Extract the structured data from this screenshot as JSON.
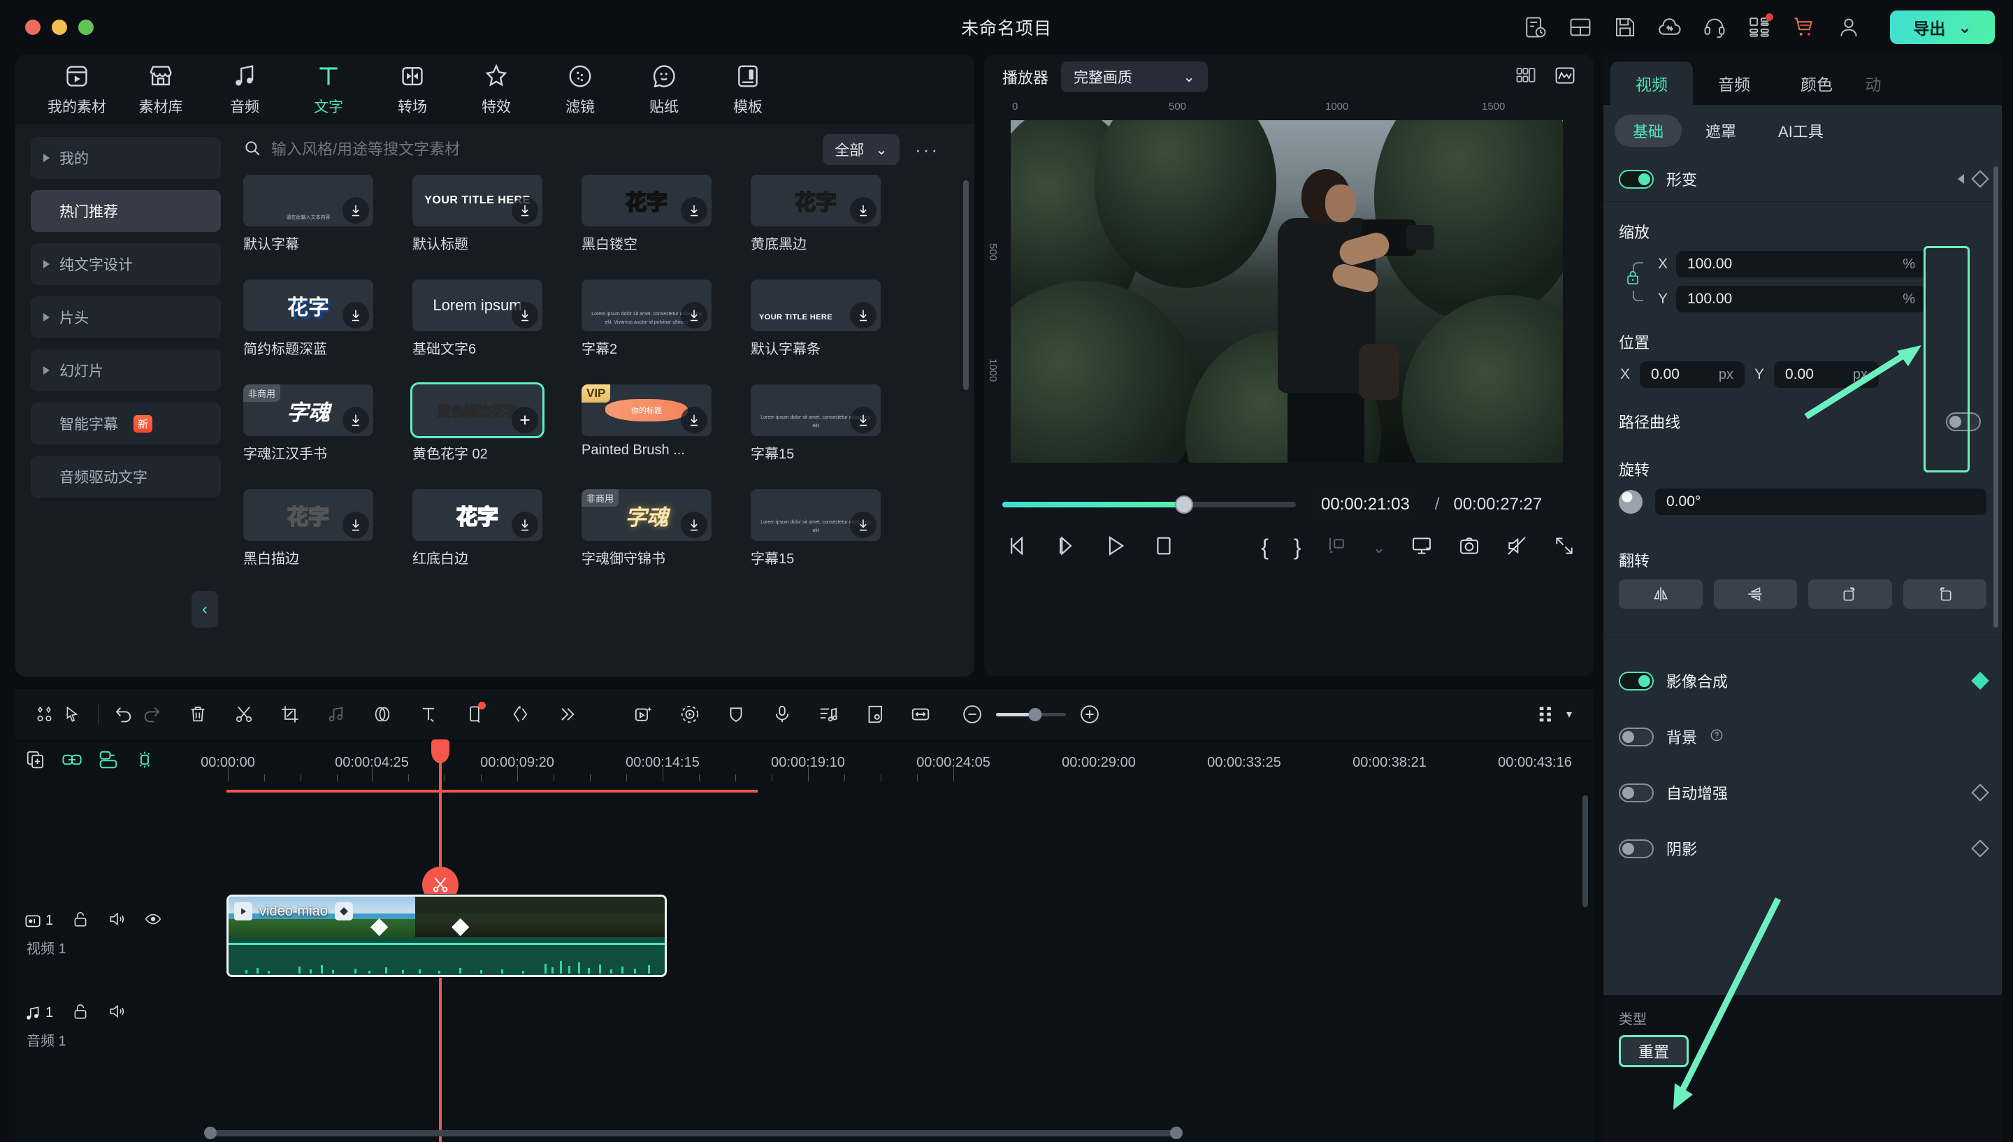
{
  "window": {
    "title": "未命名项目",
    "traffic_lights": [
      "close",
      "minimize",
      "zoom"
    ]
  },
  "titlebar_icons": [
    {
      "name": "task-history-icon"
    },
    {
      "name": "layout-icon"
    },
    {
      "name": "save-icon"
    },
    {
      "name": "cloud-upload-icon"
    },
    {
      "name": "headset-support-icon"
    },
    {
      "name": "apps-grid-icon",
      "badge": true
    },
    {
      "name": "shopping-cart-icon"
    },
    {
      "name": "user-account-icon"
    }
  ],
  "export": {
    "label": "导出",
    "chevron": "⌄"
  },
  "categories": [
    {
      "label": "我的素材",
      "icon": "my-media-icon",
      "active": false
    },
    {
      "label": "素材库",
      "icon": "stock-library-icon",
      "active": false
    },
    {
      "label": "音频",
      "icon": "audio-note-icon",
      "active": false
    },
    {
      "label": "文字",
      "icon": "text-T-icon",
      "active": true
    },
    {
      "label": "转场",
      "icon": "transition-icon",
      "active": false
    },
    {
      "label": "特效",
      "icon": "effects-star-icon",
      "active": false
    },
    {
      "label": "滤镜",
      "icon": "filter-circle-icon",
      "active": false
    },
    {
      "label": "贴纸",
      "icon": "sticker-smile-icon",
      "active": false
    },
    {
      "label": "模板",
      "icon": "template-icon",
      "active": false
    }
  ],
  "sidebar": {
    "items": [
      {
        "label": "我的",
        "expandable": true,
        "active": false,
        "badge": null
      },
      {
        "label": "热门推荐",
        "expandable": false,
        "active": true,
        "badge": null
      },
      {
        "label": "纯文字设计",
        "expandable": true,
        "active": false,
        "badge": null
      },
      {
        "label": "片头",
        "expandable": true,
        "active": false,
        "badge": null
      },
      {
        "label": "幻灯片",
        "expandable": true,
        "active": false,
        "badge": null
      },
      {
        "label": "智能字幕",
        "expandable": false,
        "active": false,
        "badge": "新"
      },
      {
        "label": "音频驱动文字",
        "expandable": false,
        "active": false,
        "badge": null
      }
    ],
    "collapse_icon": "chevron-left-icon"
  },
  "search": {
    "placeholder": "输入风格/用途等搜文字素材",
    "value": "",
    "icon": "search-icon"
  },
  "filter": {
    "label": "全部",
    "chevron": "⌄"
  },
  "more_menu": "···",
  "templates": [
    {
      "name": "默认字幕",
      "style": "micro",
      "preview": "请在此输入文本内容",
      "tag": null,
      "download": true,
      "selected": false
    },
    {
      "name": "默认标题",
      "style": "title-en",
      "preview": "YOUR TITLE HERE",
      "tag": null,
      "download": true,
      "selected": false
    },
    {
      "name": "黑白镂空",
      "style": "hua-white",
      "preview": "花字",
      "tag": null,
      "download": true,
      "selected": false
    },
    {
      "name": "黄底黑边",
      "style": "hua-yellow",
      "preview": "花字",
      "tag": null,
      "download": true,
      "selected": false
    },
    {
      "name": "简约标题深蓝",
      "style": "hua-blue",
      "preview": "花字",
      "tag": null,
      "download": true,
      "selected": false
    },
    {
      "name": "基础文字6",
      "style": "lorem",
      "preview": "Lorem ipsum",
      "tag": null,
      "download": true,
      "selected": false
    },
    {
      "name": "字幕2",
      "style": "micro2",
      "preview": "Lorem ipsum dolor sit amet, consectetur adipiscing elit. Vivamus auctor id pulvinar ultrices",
      "tag": null,
      "download": true,
      "selected": false
    },
    {
      "name": "默认字幕条",
      "style": "sub-title",
      "preview": "YOUR TITLE HERE",
      "tag": null,
      "download": true,
      "selected": false
    },
    {
      "name": "字魂江汉手书",
      "style": "zihun",
      "preview": "字魂",
      "tag": "非商用",
      "download": true,
      "selected": false
    },
    {
      "name": "黄色花字 02",
      "style": "selected-yellow",
      "preview": "黄色描边花字",
      "tag": null,
      "download": false,
      "add": true,
      "selected": true
    },
    {
      "name": "Painted Brush ...",
      "style": "brush",
      "preview": "你的标题",
      "tag": "VIP",
      "download": true,
      "selected": false
    },
    {
      "name": "字幕15",
      "style": "micro3",
      "preview": "Lorem ipsum dolor sit amet, consectetur adipiscing elit",
      "tag": null,
      "download": true,
      "selected": false
    },
    {
      "name": "黑白描边",
      "style": "hua-gray",
      "preview": "花字",
      "tag": null,
      "download": true,
      "selected": false
    },
    {
      "name": "红底白边",
      "style": "hua-red",
      "preview": "花字",
      "tag": null,
      "download": true,
      "selected": false
    },
    {
      "name": "字魂御守锦书",
      "style": "zihun-gold",
      "preview": "字魂",
      "tag": "非商用",
      "download": true,
      "selected": false
    },
    {
      "name": "字幕15",
      "style": "micro3",
      "preview": "Lorem ipsum dolor sit amet, consectetur adipiscing elit",
      "tag": null,
      "download": true,
      "selected": false
    }
  ],
  "player": {
    "title": "播放器",
    "quality": "完整画质",
    "quality_chevron": "⌄",
    "head_icons": [
      {
        "name": "split-view-icon"
      },
      {
        "name": "scope-waveform-icon"
      }
    ],
    "ruler_top": [
      "0",
      "500",
      "1000",
      "1500"
    ],
    "ruler_left": [
      "500",
      "1000"
    ],
    "current_time": "00:00:21:03",
    "separator": "/",
    "total_time": "00:00:27:27",
    "progress_percent": 62,
    "controls": [
      {
        "name": "prev-frame-button",
        "glyph": "prev-frame-icon"
      },
      {
        "name": "next-frame-button",
        "glyph": "next-frame-icon"
      },
      {
        "name": "play-button",
        "glyph": "play-icon"
      },
      {
        "name": "stop-button",
        "glyph": "stop-icon"
      },
      {
        "name": "mark-in-button",
        "glyph": "brace-left-icon"
      },
      {
        "name": "mark-out-button",
        "glyph": "brace-right-icon"
      },
      {
        "name": "keyframe-tool-button",
        "glyph": "keyframe-icon"
      },
      {
        "name": "keyframe-dropdown",
        "glyph": "chevron-down-icon"
      },
      {
        "name": "screen-fit-button",
        "glyph": "monitor-icon"
      },
      {
        "name": "snapshot-button",
        "glyph": "camera-icon"
      },
      {
        "name": "mute-button",
        "glyph": "mute-icon"
      },
      {
        "name": "fullscreen-button",
        "glyph": "expand-icon"
      }
    ]
  },
  "properties": {
    "tabs": [
      {
        "label": "视频",
        "active": true
      },
      {
        "label": "音频",
        "active": false
      },
      {
        "label": "颜色",
        "active": false
      },
      {
        "label": "动",
        "active": false
      }
    ],
    "sub_tabs": [
      {
        "label": "基础",
        "active": true
      },
      {
        "label": "遮罩",
        "active": false
      },
      {
        "label": "AI工具",
        "active": false
      }
    ],
    "transform": {
      "label": "形变",
      "enabled": true,
      "scale_label": "缩放",
      "scale_x_axis": "X",
      "scale_x": "100.00",
      "scale_x_unit": "%",
      "scale_y_axis": "Y",
      "scale_y": "100.00",
      "scale_y_unit": "%",
      "lock_icon": "lock-icon",
      "position_label": "位置",
      "pos_x_axis": "X",
      "pos_x": "0.00",
      "pos_x_unit": "px",
      "pos_y_axis": "Y",
      "pos_y": "0.00",
      "pos_y_unit": "px",
      "path_curve_label": "路径曲线",
      "path_curve_enabled": false,
      "rotate_label": "旋转",
      "rotate_value": "0.00°",
      "flip_label": "翻转",
      "flip_buttons": [
        {
          "name": "flip-horizontal-button"
        },
        {
          "name": "flip-vertical-button"
        },
        {
          "name": "rotate-right-button"
        },
        {
          "name": "rotate-left-button"
        }
      ]
    },
    "compositing": {
      "label": "影像合成",
      "enabled": true
    },
    "background": {
      "label": "背景",
      "enabled": false,
      "help": "?"
    },
    "auto_enhance": {
      "label": "自动增强",
      "enabled": false
    },
    "shadow": {
      "label": "阴影",
      "enabled": false
    },
    "type_label": "类型",
    "reset_label": "重置"
  },
  "timeline": {
    "toolbar_left": [
      {
        "name": "auto-layout-icon",
        "dim": false
      },
      {
        "name": "select-cursor-icon",
        "dim": false
      }
    ],
    "toolbar_edit": [
      {
        "name": "undo-icon",
        "dim": false
      },
      {
        "name": "redo-icon",
        "dim": true
      },
      {
        "name": "delete-trash-icon",
        "dim": false
      },
      {
        "name": "split-scissors-icon",
        "dim": false
      },
      {
        "name": "crop-icon",
        "dim": false
      },
      {
        "name": "audio-detach-icon",
        "dim": true
      },
      {
        "name": "color-match-icon",
        "dim": false
      },
      {
        "name": "text-T-icon",
        "dim": false
      },
      {
        "name": "crop-frame-icon",
        "dim": false,
        "badge": true
      },
      {
        "name": "speed-ramp-icon",
        "dim": false
      },
      {
        "name": "more-chevrons-icon",
        "dim": false
      }
    ],
    "toolbar_right": [
      {
        "name": "ai-smart-cutout-icon"
      },
      {
        "name": "motion-tracking-icon"
      },
      {
        "name": "mask-shape-icon"
      },
      {
        "name": "voiceover-mic-icon"
      },
      {
        "name": "audio-mixer-icon"
      },
      {
        "name": "auto-beat-sync-icon"
      },
      {
        "name": "fit-to-width-icon"
      }
    ],
    "zoom": {
      "minus": "−",
      "plus": "+",
      "value_percent": 56
    },
    "grid_icon": "grid-view-icon",
    "grid_chevron": "▾",
    "track_tool_icons": [
      {
        "name": "add-track-icon",
        "active": false
      },
      {
        "name": "link-clips-icon",
        "active": true
      },
      {
        "name": "group-clips-icon",
        "active": true
      },
      {
        "name": "markers-icon",
        "active": true
      }
    ],
    "ruler_labels": [
      "00:00:00",
      "00:00:04:25",
      "00:00:09:20",
      "00:00:14:15",
      "00:00:19:10",
      "00:00:24:05",
      "00:00:29:00",
      "00:00:33:25",
      "00:00:38:21",
      "00:00:43:16"
    ],
    "tracks": [
      {
        "type": "video",
        "index": "1",
        "label": "视频 1",
        "icons": [
          "video-track-icon",
          "unlock-icon",
          "speaker-icon",
          "eye-icon"
        ]
      },
      {
        "type": "audio",
        "index": "1",
        "label": "音频 1",
        "icons": [
          "audio-track-icon",
          "unlock-icon",
          "speaker-icon"
        ]
      }
    ],
    "clip": {
      "name": "video-miao",
      "play_icon": "play-icon",
      "keyframe_icon": "keyframe-diamond-icon"
    },
    "split_bubble_icon": "scissors-icon"
  }
}
